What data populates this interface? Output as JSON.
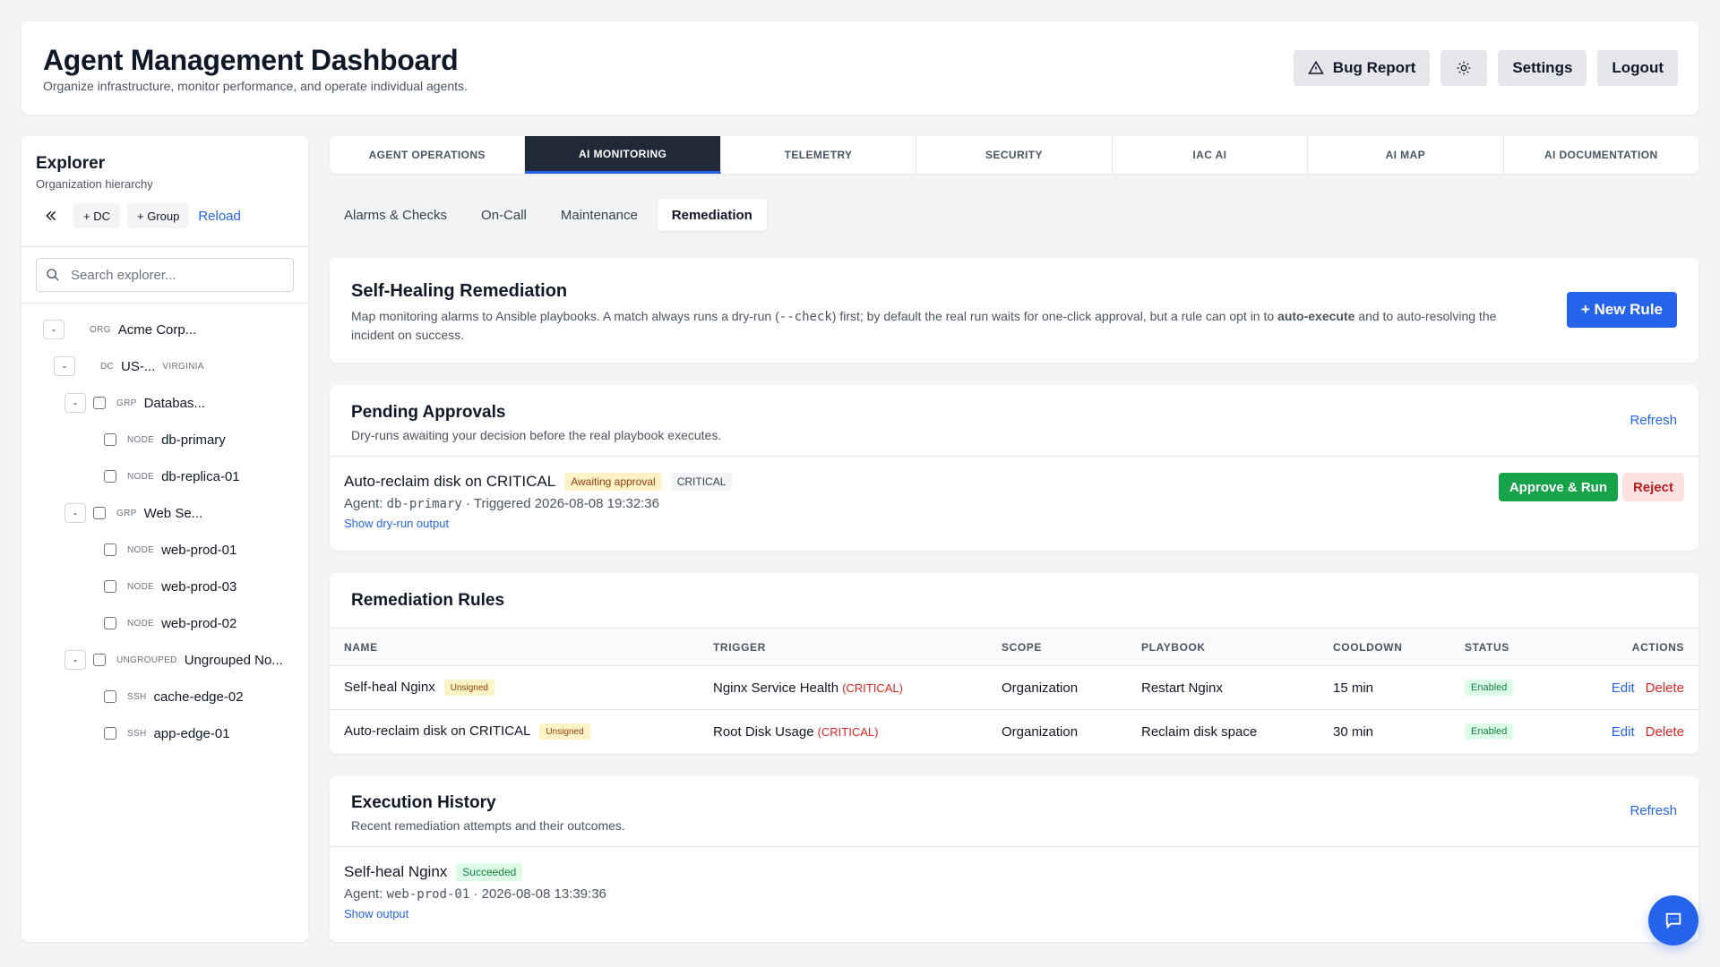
{
  "header": {
    "title": "Agent Management Dashboard",
    "subtitle": "Organize infrastructure, monitor performance, and operate individual agents.",
    "bug_report": "Bug Report",
    "settings": "Settings",
    "logout": "Logout"
  },
  "explorer": {
    "title": "Explorer",
    "subtitle": "Organization hierarchy",
    "add_dc": "+ DC",
    "add_group": "+ Group",
    "reload": "Reload",
    "search_placeholder": "Search explorer...",
    "tree": [
      {
        "toggle": "-",
        "type": "ORG",
        "name": "Acme Corp..."
      },
      {
        "toggle": "-",
        "type": "DC",
        "name": "US-...",
        "meta": "VIRGINIA"
      },
      {
        "toggle": "-",
        "type": "GRP",
        "name": "Databas..."
      },
      {
        "type": "NODE",
        "name": "db-primary"
      },
      {
        "type": "NODE",
        "name": "db-replica-01"
      },
      {
        "toggle": "-",
        "type": "GRP",
        "name": "Web Se..."
      },
      {
        "type": "NODE",
        "name": "web-prod-01"
      },
      {
        "type": "NODE",
        "name": "web-prod-03"
      },
      {
        "type": "NODE",
        "name": "web-prod-02"
      },
      {
        "toggle": "-",
        "type": "UNGROUPED",
        "name": "Ungrouped No..."
      },
      {
        "type": "SSH",
        "name": "cache-edge-02"
      },
      {
        "type": "SSH",
        "name": "app-edge-01"
      }
    ]
  },
  "tabs": [
    "AGENT OPERATIONS",
    "AI MONITORING",
    "TELEMETRY",
    "SECURITY",
    "IAC AI",
    "AI MAP",
    "AI DOCUMENTATION"
  ],
  "subtabs": [
    "Alarms & Checks",
    "On-Call",
    "Maintenance",
    "Remediation"
  ],
  "remediation": {
    "title": "Self-Healing Remediation",
    "desc_1": "Map monitoring alarms to Ansible playbooks. A match always runs a dry-run (",
    "desc_code": "--check",
    "desc_2": ") first; by default the real run waits for one-click approval, but a rule can opt in to ",
    "desc_bold": "auto-execute",
    "desc_3": " and to auto-resolving the incident on success.",
    "new_rule": "+ New Rule"
  },
  "pending": {
    "title": "Pending Approvals",
    "subtitle": "Dry-runs awaiting your decision before the real playbook executes.",
    "refresh": "Refresh",
    "item": {
      "name": "Auto-reclaim disk on CRITICAL",
      "status": "Awaiting approval",
      "severity": "CRITICAL",
      "agent_label": "Agent: ",
      "agent": "db-primary",
      "triggered": " · Triggered 2026-08-08 19:32:36",
      "show": "Show dry-run output",
      "approve": "Approve & Run",
      "reject": "Reject"
    }
  },
  "rules": {
    "title": "Remediation Rules",
    "columns": [
      "NAME",
      "TRIGGER",
      "SCOPE",
      "PLAYBOOK",
      "COOLDOWN",
      "STATUS",
      "ACTIONS"
    ],
    "rows": [
      {
        "name": "Self-heal Nginx",
        "signed": "Unsigned",
        "trigger": "Nginx Service Health",
        "severity": "(CRITICAL)",
        "scope": "Organization",
        "playbook": "Restart Nginx",
        "cooldown": "15 min",
        "status": "Enabled",
        "edit": "Edit",
        "delete": "Delete"
      },
      {
        "name": "Auto-reclaim disk on CRITICAL",
        "signed": "Unsigned",
        "trigger": "Root Disk Usage",
        "severity": "(CRITICAL)",
        "scope": "Organization",
        "playbook": "Reclaim disk space",
        "cooldown": "30 min",
        "status": "Enabled",
        "edit": "Edit",
        "delete": "Delete"
      }
    ]
  },
  "history": {
    "title": "Execution History",
    "subtitle": "Recent remediation attempts and their outcomes.",
    "refresh": "Refresh",
    "item": {
      "name": "Self-heal Nginx",
      "status": "Succeeded",
      "agent_label": "Agent: ",
      "agent": "web-prod-01",
      "time": " · 2026-08-08 13:39:36",
      "show": "Show output"
    }
  },
  "colors": {
    "accent": "#2563eb",
    "dark": "#1f2937",
    "success": "#16a34a",
    "danger": "#dc2626"
  }
}
